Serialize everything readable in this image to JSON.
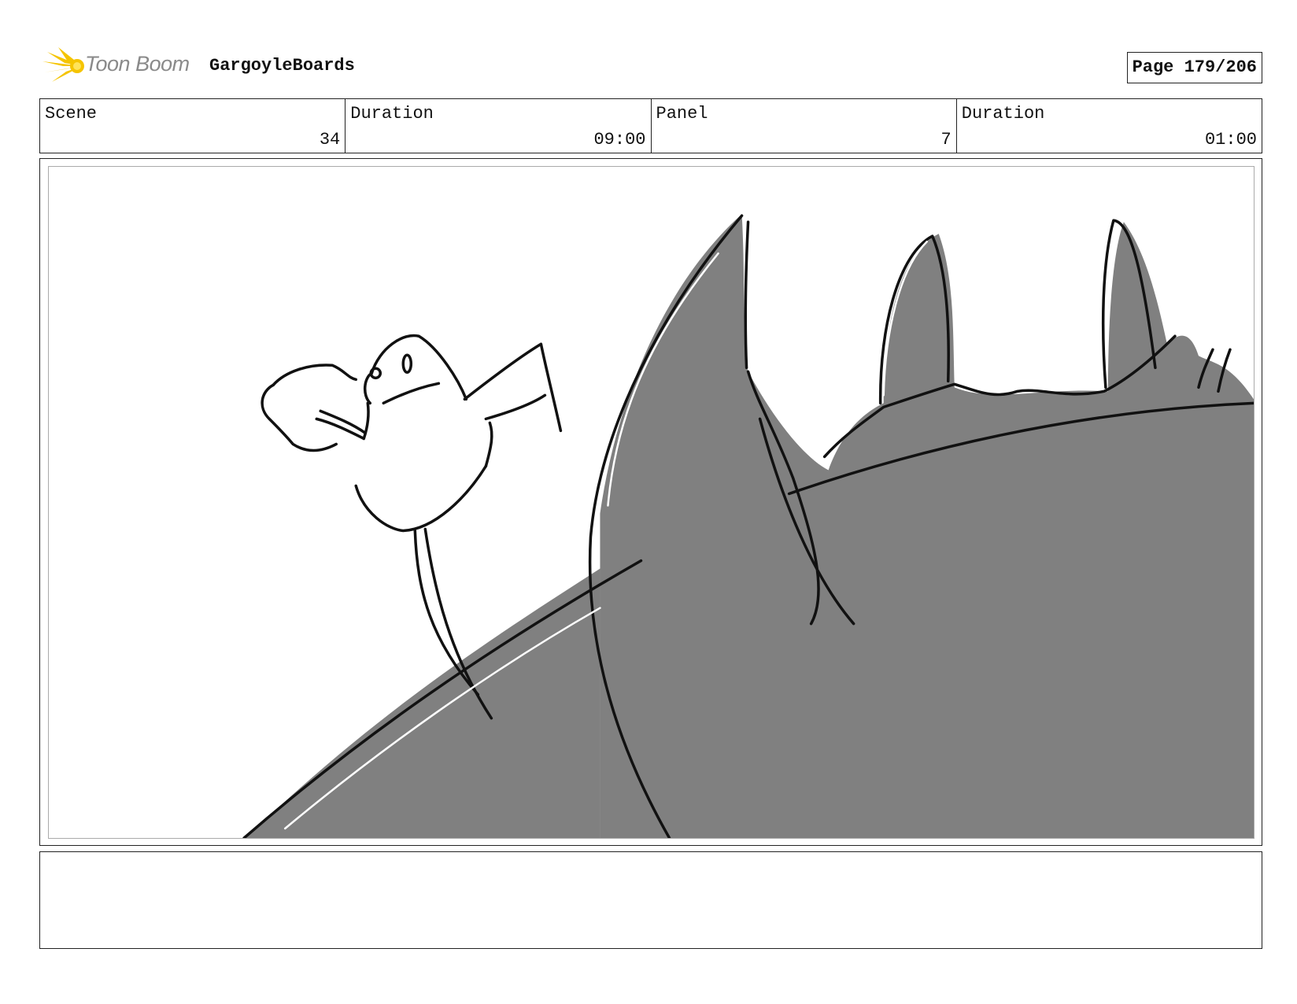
{
  "header": {
    "logo_text": "Toon Boom",
    "project_title": "GargoyleBoards",
    "page_indicator": "Page 179/206"
  },
  "info": [
    {
      "label": "Scene",
      "value": "34"
    },
    {
      "label": "Duration",
      "value": "09:00"
    },
    {
      "label": "Panel",
      "value": "7"
    },
    {
      "label": "Duration",
      "value": "01:00"
    }
  ],
  "notes": {
    "text": ""
  },
  "colors": {
    "logo_yellow": "#f5c400",
    "logo_gray": "#8a8a8a",
    "shadow_gray": "#808080",
    "line": "#111111"
  }
}
